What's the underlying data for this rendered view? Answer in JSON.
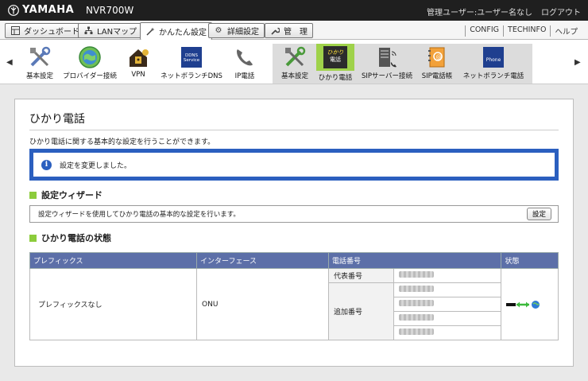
{
  "header": {
    "brand": "YAMAHA",
    "model": "NVR700W",
    "user_label": "管理ユーザー:ユーザー名なし",
    "logout_label": "ログアウト"
  },
  "tabs": [
    {
      "label": "ダッシュボード",
      "icon": "grid-icon"
    },
    {
      "label": "LANマップ",
      "icon": "map-icon"
    },
    {
      "label": "かんたん設定",
      "icon": "wand-icon",
      "active": true
    },
    {
      "label": "詳細設定",
      "icon": "gear-icon"
    },
    {
      "label": "管　理",
      "icon": "wrench-icon"
    }
  ],
  "top_links": [
    "CONFIG",
    "TECHINFO",
    "ヘルプ"
  ],
  "nav_left": [
    {
      "label": "基本設定",
      "icon": "tools-icon"
    },
    {
      "label": "プロバイダー接続",
      "icon": "globe-icon"
    },
    {
      "label": "VPN",
      "icon": "vpn-house-icon"
    },
    {
      "label": "ネットボランチDNS",
      "icon": "dns-service-icon",
      "pic_text": "DDNS Service"
    },
    {
      "label": "IP電話",
      "icon": "telephone-icon"
    }
  ],
  "nav_right": [
    {
      "label": "基本設定",
      "icon": "tools-icon"
    },
    {
      "label": "ひかり電話",
      "icon": "hikari-phone-icon",
      "pic_text1": "ひかり",
      "pic_text2": "電話",
      "selected": true
    },
    {
      "label": "SIPサーバー接続",
      "icon": "sip-server-icon"
    },
    {
      "label": "SIP電話帳",
      "icon": "phonebook-icon"
    },
    {
      "label": "ネットボランチ電話",
      "icon": "phone-service-icon",
      "pic_text": "Phone"
    }
  ],
  "page": {
    "title": "ひかり電話",
    "description": "ひかり電話に関する基本的な設定を行うことができます。",
    "notice": "設定を変更しました。",
    "wizard_heading": "設定ウィザード",
    "wizard_text": "設定ウィザードを使用してひかり電話の基本的な設定を行います。",
    "wizard_button": "設定",
    "status_heading": "ひかり電話の状態"
  },
  "status_table": {
    "headers": [
      "プレフィックス",
      "インターフェース",
      "電話番号",
      "状態"
    ],
    "prefix": "プレフィックスなし",
    "interface": "ONU",
    "main_number_label": "代表番号",
    "additional_number_label": "追加番号",
    "status_icon": "phone-connected-globe-icon"
  },
  "colors": {
    "accent_blue": "#2b5fbf",
    "table_header": "#5c6fa8",
    "section_green": "#8ccc3c",
    "selected_nav": "#9fd24a"
  }
}
